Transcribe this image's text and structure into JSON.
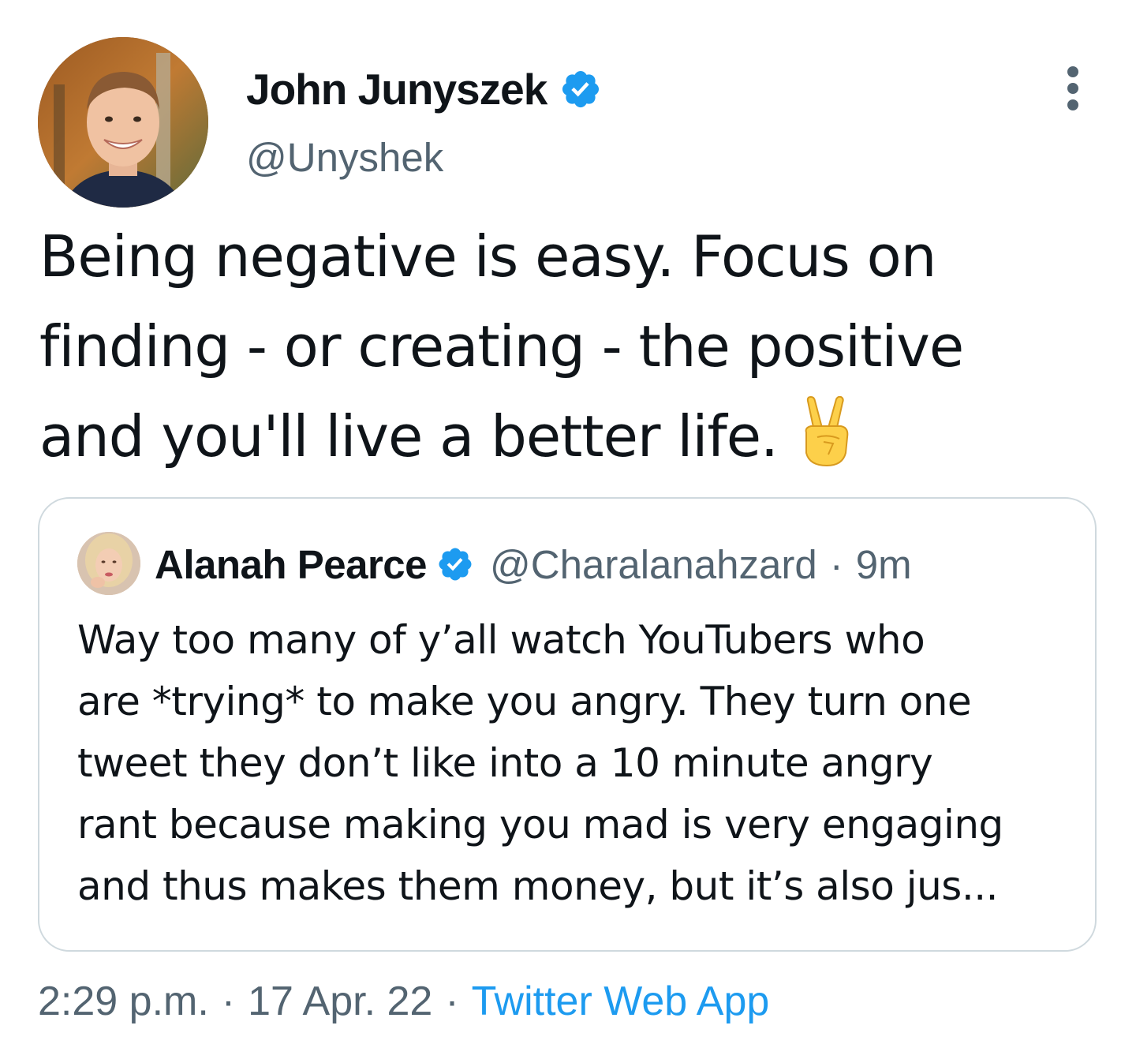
{
  "tweet": {
    "author": {
      "name": "John Junyszek",
      "handle": "@Unyshek",
      "verified": true
    },
    "text_lines": [
      "Being negative is easy. Focus on",
      "finding - or creating - the positive",
      "and you'll live a better life."
    ],
    "emoji": "victory-hand-emoji",
    "quoted": {
      "author": {
        "name": "Alanah Pearce",
        "handle": "@Charalanahzard",
        "verified": true
      },
      "separator": "·",
      "time": "9m",
      "text_lines": [
        "Way too many of y’all watch YouTubers who",
        "are *trying* to make you angry. They turn one",
        "tweet they don’t like into a 10 minute angry",
        "rant because making you mad is very engaging",
        "and thus makes them money, but it’s also jus..."
      ]
    },
    "footer": {
      "time": "2:29 p.m.",
      "separator": "·",
      "date": "17 Apr. 22",
      "source": "Twitter Web App"
    }
  },
  "colors": {
    "text_primary": "#0f1419",
    "text_secondary": "#536471",
    "link_blue": "#1d9bf0",
    "verified_blue": "#1d9bf0",
    "card_border": "#cfd9de"
  },
  "icons": {
    "verified": "verified-badge-icon",
    "more": "more-options-icon"
  }
}
